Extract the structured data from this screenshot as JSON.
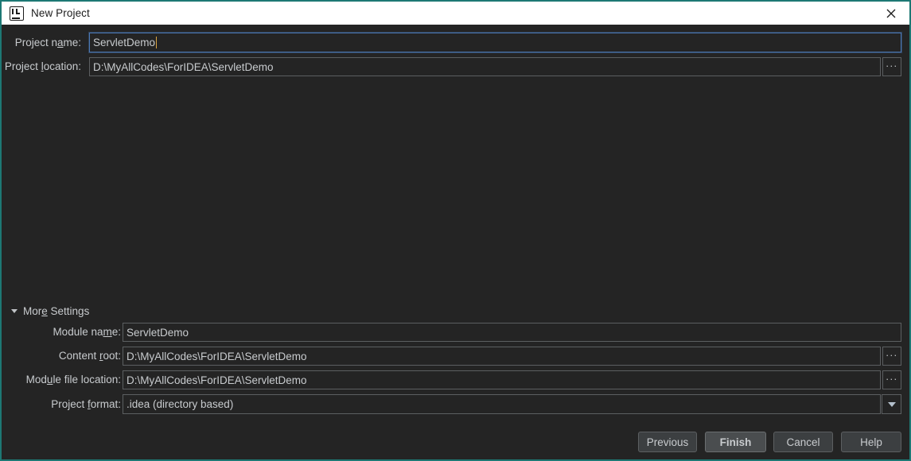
{
  "window": {
    "title": "New Project",
    "icon": "intellij-idea-logo",
    "close_label": "✕",
    "border_color": "#1d7874",
    "titlebar_bg": "#ffffff",
    "body_bg": "#242424",
    "accent_focus_color": "#4b78b5",
    "caret_color": "#d9a443"
  },
  "top_form": {
    "fields": [
      {
        "label_pre": "Project n",
        "label_mnemonic": "a",
        "label_post": "me:",
        "value": "ServletDemo",
        "focused": true,
        "has_browse": false
      },
      {
        "label_pre": "Project ",
        "label_mnemonic": "l",
        "label_post": "ocation:",
        "value": "D:\\MyAllCodes\\ForIDEA\\ServletDemo",
        "focused": false,
        "has_browse": true,
        "browse_label": "..."
      }
    ]
  },
  "more_settings": {
    "label_pre": "Mor",
    "label_mnemonic": "e",
    "label_mid": " Settin",
    "label_mnemonic2": "g",
    "label_post": "s",
    "expanded": true,
    "triangle": "triangle-down"
  },
  "settings_form": {
    "fields": [
      {
        "label_pre": "Module na",
        "label_mnemonic": "m",
        "label_post": "e:",
        "value": "ServletDemo",
        "type": "text",
        "has_browse": false
      },
      {
        "label_pre": "Content ",
        "label_mnemonic": "r",
        "label_post": "oot:",
        "value": "D:\\MyAllCodes\\ForIDEA\\ServletDemo",
        "type": "text",
        "has_browse": true,
        "browse_label": "..."
      },
      {
        "label_pre": "Mod",
        "label_mnemonic": "u",
        "label_post": "le file location:",
        "value": "D:\\MyAllCodes\\ForIDEA\\ServletDemo",
        "type": "text",
        "has_browse": true,
        "browse_label": "..."
      },
      {
        "label_pre": "Project ",
        "label_mnemonic": "f",
        "label_post": "ormat:",
        "value": ".idea (directory based)",
        "type": "combo",
        "has_browse": false,
        "options": [
          ".idea (directory based)"
        ]
      }
    ]
  },
  "footer": {
    "buttons": [
      {
        "label": "Previous",
        "default": false
      },
      {
        "label": "Finish",
        "default": true
      },
      {
        "label": "Cancel",
        "default": false
      },
      {
        "label": "Help",
        "default": false
      }
    ]
  }
}
